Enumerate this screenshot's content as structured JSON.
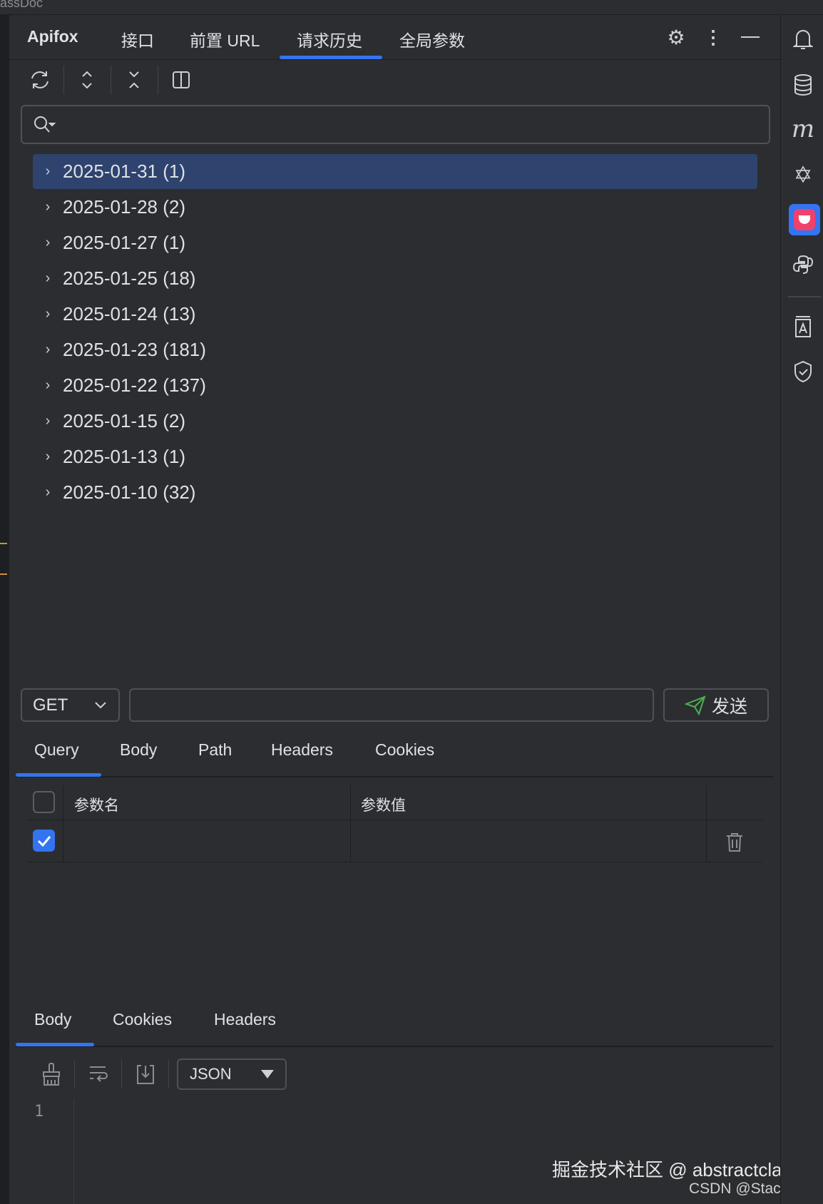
{
  "window": {
    "title_fragment": "assDoc"
  },
  "header": {
    "brand": "Apifox",
    "tabs": [
      {
        "label": "接口"
      },
      {
        "label": "前置 URL"
      },
      {
        "label": "请求历史",
        "active": true
      },
      {
        "label": "全局参数"
      }
    ]
  },
  "toolbar": {
    "icons": [
      "refresh-icon",
      "expand-all-icon",
      "collapse-all-icon",
      "split-view-icon"
    ]
  },
  "search": {
    "placeholder": "",
    "value": ""
  },
  "history": [
    {
      "label": "2025-01-31 (1)",
      "selected": true
    },
    {
      "label": "2025-01-28 (2)"
    },
    {
      "label": "2025-01-27 (1)"
    },
    {
      "label": "2025-01-25 (18)"
    },
    {
      "label": "2025-01-24 (13)"
    },
    {
      "label": "2025-01-23 (181)"
    },
    {
      "label": "2025-01-22 (137)"
    },
    {
      "label": "2025-01-15 (2)"
    },
    {
      "label": "2025-01-13 (1)"
    },
    {
      "label": "2025-01-10 (32)"
    }
  ],
  "request": {
    "method": "GET",
    "url": "",
    "send_label": "发送",
    "tabs": [
      "Query",
      "Body",
      "Path",
      "Headers",
      "Cookies"
    ],
    "params": {
      "col_name": "参数名",
      "col_value": "参数值",
      "rows": [
        {
          "checked": true,
          "name": "",
          "value": ""
        }
      ]
    }
  },
  "response": {
    "tabs": [
      "Body",
      "Cookies",
      "Headers"
    ],
    "format": "JSON",
    "line_number": "1"
  },
  "watermark": {
    "line1": "掘金技术社区 @ abstractclass",
    "line2": "CSDN @Stack Qxd"
  },
  "colors": {
    "accent": "#3574f0",
    "selected_row": "#2e436e",
    "send_icon": "#4caf50"
  }
}
